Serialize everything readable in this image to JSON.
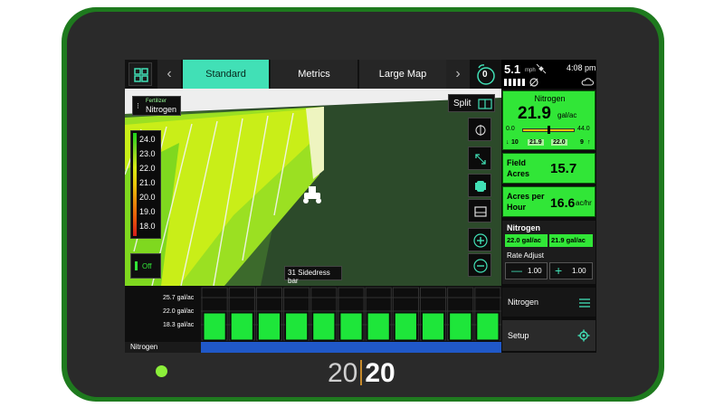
{
  "brand": {
    "left": "20",
    "right": "20"
  },
  "topbar": {
    "tabs": [
      {
        "label": "Standard",
        "active": true
      },
      {
        "label": "Metrics",
        "active": false
      },
      {
        "label": "Large Map",
        "active": false
      }
    ],
    "alert_count": "0"
  },
  "status": {
    "speed": "5.1",
    "speed_unit": "mph",
    "time": "4:08 pm"
  },
  "map": {
    "product_chip": {
      "small": "Fertilizer",
      "label": "Nitrogen"
    },
    "split_label": "Split",
    "implement_label": "31 Sidedress bar",
    "legend": {
      "values": [
        "24.0",
        "23.0",
        "22.0",
        "21.0",
        "20.0",
        "19.0",
        "18.0"
      ],
      "colors": [
        "#1bd41b",
        "#7ed321",
        "#d6ea14",
        "#e8c60a",
        "#e88a0a",
        "#e8550a",
        "#d41b1b"
      ]
    },
    "toggle_label": "Off"
  },
  "rows": {
    "scale": [
      "25.7 gal/ac",
      "22.0 gal/ac",
      "18.3 gal/ac"
    ],
    "row_count": 11,
    "levels": [
      0.5,
      0.5,
      0.5,
      0.5,
      0.5,
      0.5,
      0.5,
      0.5,
      0.5,
      0.5,
      0.5
    ]
  },
  "boom_label": "Nitrogen",
  "panel": {
    "rate": {
      "title": "Nitrogen",
      "value": "21.9",
      "unit": "gal/ac",
      "min": "0.0",
      "max": "44.0",
      "left_count": "10",
      "a": "21.9",
      "b": "22.0",
      "right_count": "9"
    },
    "field_acres": {
      "label1": "Field",
      "label2": "Acres",
      "value": "15.7"
    },
    "acres_per_hour": {
      "label1": "Acres per",
      "label2": "Hour",
      "value": "16.6",
      "unit": "ac/hr"
    },
    "nitrogen_box": {
      "title": "Nitrogen",
      "v1": "22.0 gal/ac",
      "v2": "21.9 gal/ac",
      "rate_adjust": "Rate Adjust",
      "minus_val": "1.00",
      "plus_val": "1.00"
    },
    "menu_label": "Nitrogen",
    "setup_label": "Setup"
  },
  "colors": {
    "accent_tab": "#41e0b6",
    "green_box": "#31e637",
    "boom_blue": "#2058c8",
    "device_green": "#1e7a1e"
  }
}
